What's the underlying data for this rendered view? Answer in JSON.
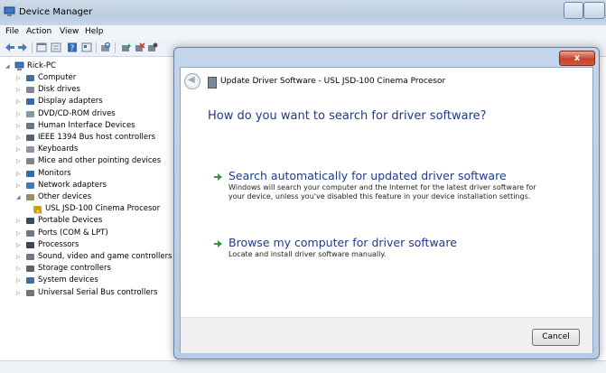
{
  "window": {
    "title": "Device Manager"
  },
  "menu": [
    "File",
    "Action",
    "View",
    "Help"
  ],
  "toolbar_icons": [
    "back-icon",
    "forward-icon",
    "show-hide-icon",
    "properties-icon",
    "help-icon",
    "view-icon",
    "scan-hardware-icon",
    "update-driver-icon",
    "uninstall-icon",
    "disable-icon"
  ],
  "tree": {
    "root": "Rick-PC",
    "items": [
      {
        "label": "Computer",
        "icon": "computer-icon",
        "color": "#3a6ea5"
      },
      {
        "label": "Disk drives",
        "icon": "disk-drive-icon",
        "color": "#7b8a99"
      },
      {
        "label": "Display adapters",
        "icon": "display-adapter-icon",
        "color": "#2f6db5"
      },
      {
        "label": "DVD/CD-ROM drives",
        "icon": "dvd-drive-icon",
        "color": "#8a96a3"
      },
      {
        "label": "Human Interface Devices",
        "icon": "hid-icon",
        "color": "#6b7785"
      },
      {
        "label": "IEEE 1394 Bus host controllers",
        "icon": "ieee1394-icon",
        "color": "#566271"
      },
      {
        "label": "Keyboards",
        "icon": "keyboard-icon",
        "color": "#8d97a3"
      },
      {
        "label": "Mice and other pointing devices",
        "icon": "mouse-icon",
        "color": "#7c8692"
      },
      {
        "label": "Monitors",
        "icon": "monitor-icon",
        "color": "#2f6db5"
      },
      {
        "label": "Network adapters",
        "icon": "network-adapter-icon",
        "color": "#3b7ac2"
      },
      {
        "label": "Other devices",
        "icon": "other-devices-icon",
        "color": "#9a8f62",
        "expanded": true
      },
      {
        "label": "USL JSD-100 Cinema Procesor",
        "icon": "unknown-device-warning-icon",
        "color": "#d4a017",
        "child": true
      },
      {
        "label": "Portable Devices",
        "icon": "portable-device-icon",
        "color": "#344a66"
      },
      {
        "label": "Ports (COM & LPT)",
        "icon": "port-icon",
        "color": "#6d7681"
      },
      {
        "label": "Processors",
        "icon": "processor-icon",
        "color": "#3d4650"
      },
      {
        "label": "Sound, video and game controllers",
        "icon": "sound-icon",
        "color": "#6f7782"
      },
      {
        "label": "Storage controllers",
        "icon": "storage-controller-icon",
        "color": "#5b6470"
      },
      {
        "label": "System devices",
        "icon": "system-device-icon",
        "color": "#3a6ea5"
      },
      {
        "label": "Universal Serial Bus controllers",
        "icon": "usb-icon",
        "color": "#6c7580"
      }
    ]
  },
  "dialog": {
    "header": "Update Driver Software - USL JSD-100 Cinema Procesor",
    "close": "x",
    "question": "How do you want to search for driver software?",
    "option1": {
      "title": "Search automatically for updated driver software",
      "desc": "Windows will search your computer and the Internet for the latest driver software for your device, unless you've disabled this feature in your device installation settings."
    },
    "option2": {
      "title": "Browse my computer for driver software",
      "desc": "Locate and install driver software manually."
    },
    "cancel": "Cancel"
  },
  "colors": {
    "accent_text": "#1e3a8a",
    "arrow": "#2e9a3a",
    "close": "#c7432a"
  }
}
